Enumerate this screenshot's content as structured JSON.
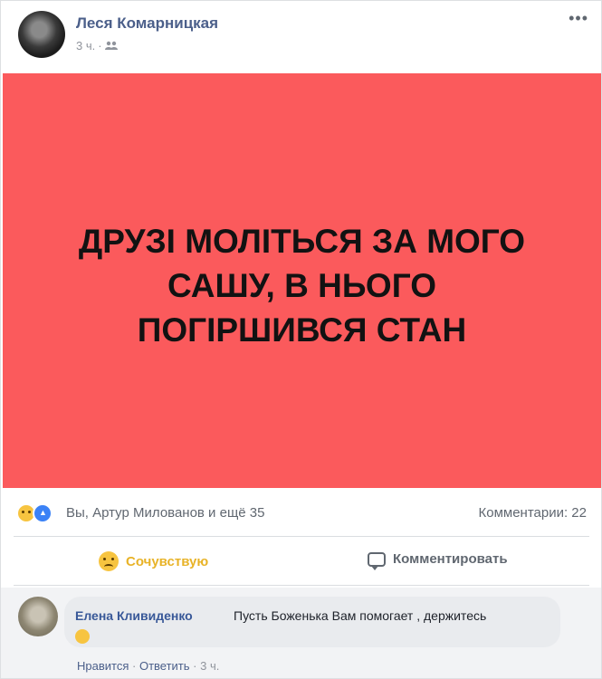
{
  "post": {
    "author": "Леся Комарницкая",
    "time": "3 ч.",
    "privacy_icon": "friends-icon",
    "banner_text": "ДРУЗІ МОЛІТЬСЯ ЗА МОГО САШУ, В НЬОГО ПОГІРШИВСЯ СТАН",
    "banner_color": "#fb5a5c"
  },
  "stats": {
    "reactions_text": "Вы, Артур Милованов и ещё 35",
    "comments_text": "Комментарии: 22"
  },
  "actions": {
    "sympathy_label": "Сочувствую",
    "comment_label": "Комментировать"
  },
  "comment": {
    "author": "Елена Кливиденко",
    "text": "Пусть Боженька Вам помогает , держитесь",
    "like_label": "Нравится",
    "reply_label": "Ответить",
    "time": "3 ч."
  }
}
